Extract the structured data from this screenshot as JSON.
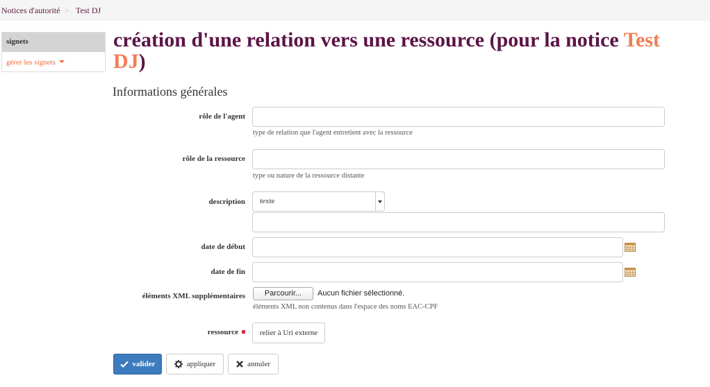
{
  "breadcrumb": {
    "home": "Notices d'autorité",
    "separator": ">",
    "current": "Test DJ"
  },
  "sidebar": {
    "title": "signets",
    "manage_link": "gérer les signets"
  },
  "page": {
    "title_prefix": "création d'une relation vers une ressource (pour la notice ",
    "title_entity": "Test DJ",
    "title_suffix": ")",
    "section": "Informations générales"
  },
  "form": {
    "agent_role": {
      "label": "rôle de l'agent",
      "value": "",
      "help": "type de relation que l'agent entretient avec la ressource"
    },
    "resource_role": {
      "label": "rôle de la ressource",
      "value": "",
      "help": "type ou nature de la ressource distante"
    },
    "description": {
      "label": "description",
      "format_selected": "texte",
      "value": ""
    },
    "start_date": {
      "label": "date de début",
      "value": ""
    },
    "end_date": {
      "label": "date de fin",
      "value": ""
    },
    "xml": {
      "label": "éléments XML supplémentaires",
      "browse_label": "Parcourir...",
      "file_status": "Aucun fichier sélectionné.",
      "help": "éléments XML non contenus dans l'espace des noms EAC-CPF"
    },
    "resource": {
      "label": "ressource",
      "link_button": "relier à Uri externe"
    }
  },
  "actions": {
    "validate": "valider",
    "apply": "appliquer",
    "cancel": "annuler"
  },
  "colors": {
    "title": "#5b1446",
    "accent": "#f47c55",
    "primary": "#3c7bbd",
    "required": "#d9303e"
  },
  "icons": {
    "caret": "chevron-down-icon",
    "calendar": "calendar-icon",
    "validate": "check-icon",
    "apply": "gear-icon",
    "cancel": "close-icon"
  }
}
